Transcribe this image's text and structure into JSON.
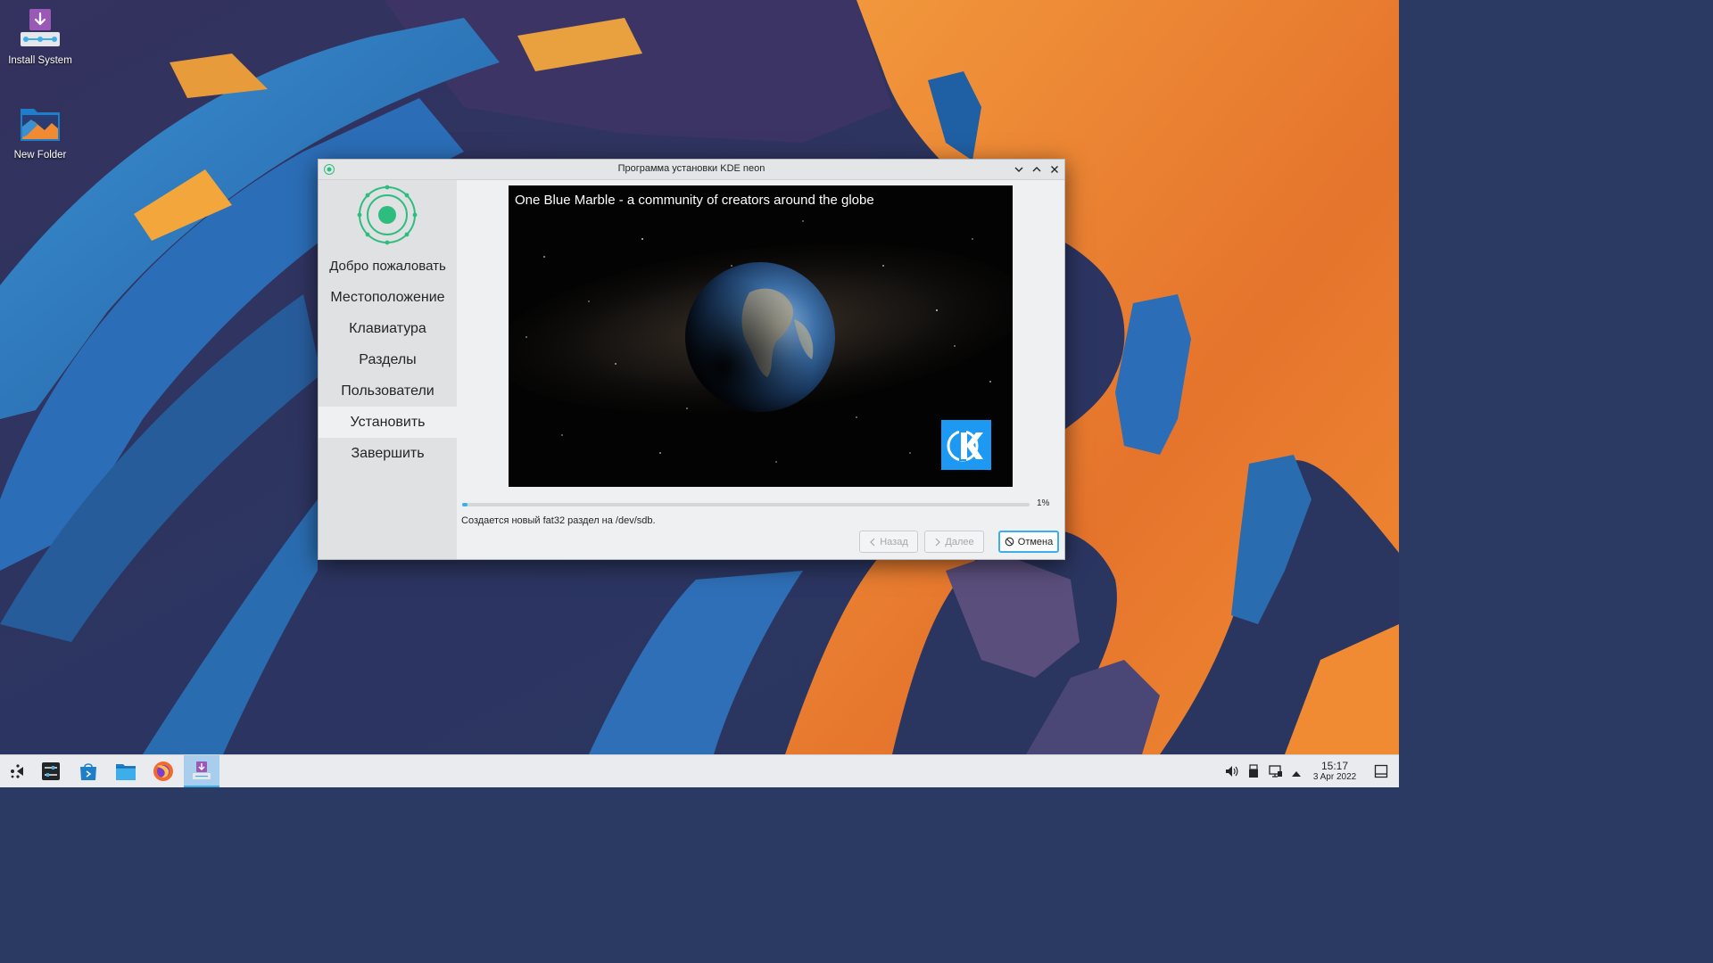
{
  "desktop": {
    "icons": [
      {
        "label": "Install System"
      },
      {
        "label": "New Folder"
      }
    ]
  },
  "window": {
    "title": "Программа установки KDE neon",
    "steps": [
      {
        "label": "Добро пожаловать"
      },
      {
        "label": "Местоположение"
      },
      {
        "label": "Клавиатура"
      },
      {
        "label": "Разделы"
      },
      {
        "label": "Пользователи"
      },
      {
        "label": "Установить",
        "active": true
      },
      {
        "label": "Завершить"
      }
    ],
    "slideshow": {
      "caption": "One Blue Marble - a community of creators around the globe"
    },
    "progress": {
      "percent": 1,
      "label": "1%"
    },
    "status": "Создается новый fat32 раздел на /dev/sdb.",
    "buttons": {
      "back": "Назад",
      "next": "Далее",
      "cancel": "Отмена"
    }
  },
  "taskbar": {
    "clock_time": "15:17",
    "clock_date": "3 Apr 2022"
  },
  "colors": {
    "accent": "#3daee9",
    "calamares_green": "#2ebd7f",
    "kde_blue": "#1d99f3"
  }
}
